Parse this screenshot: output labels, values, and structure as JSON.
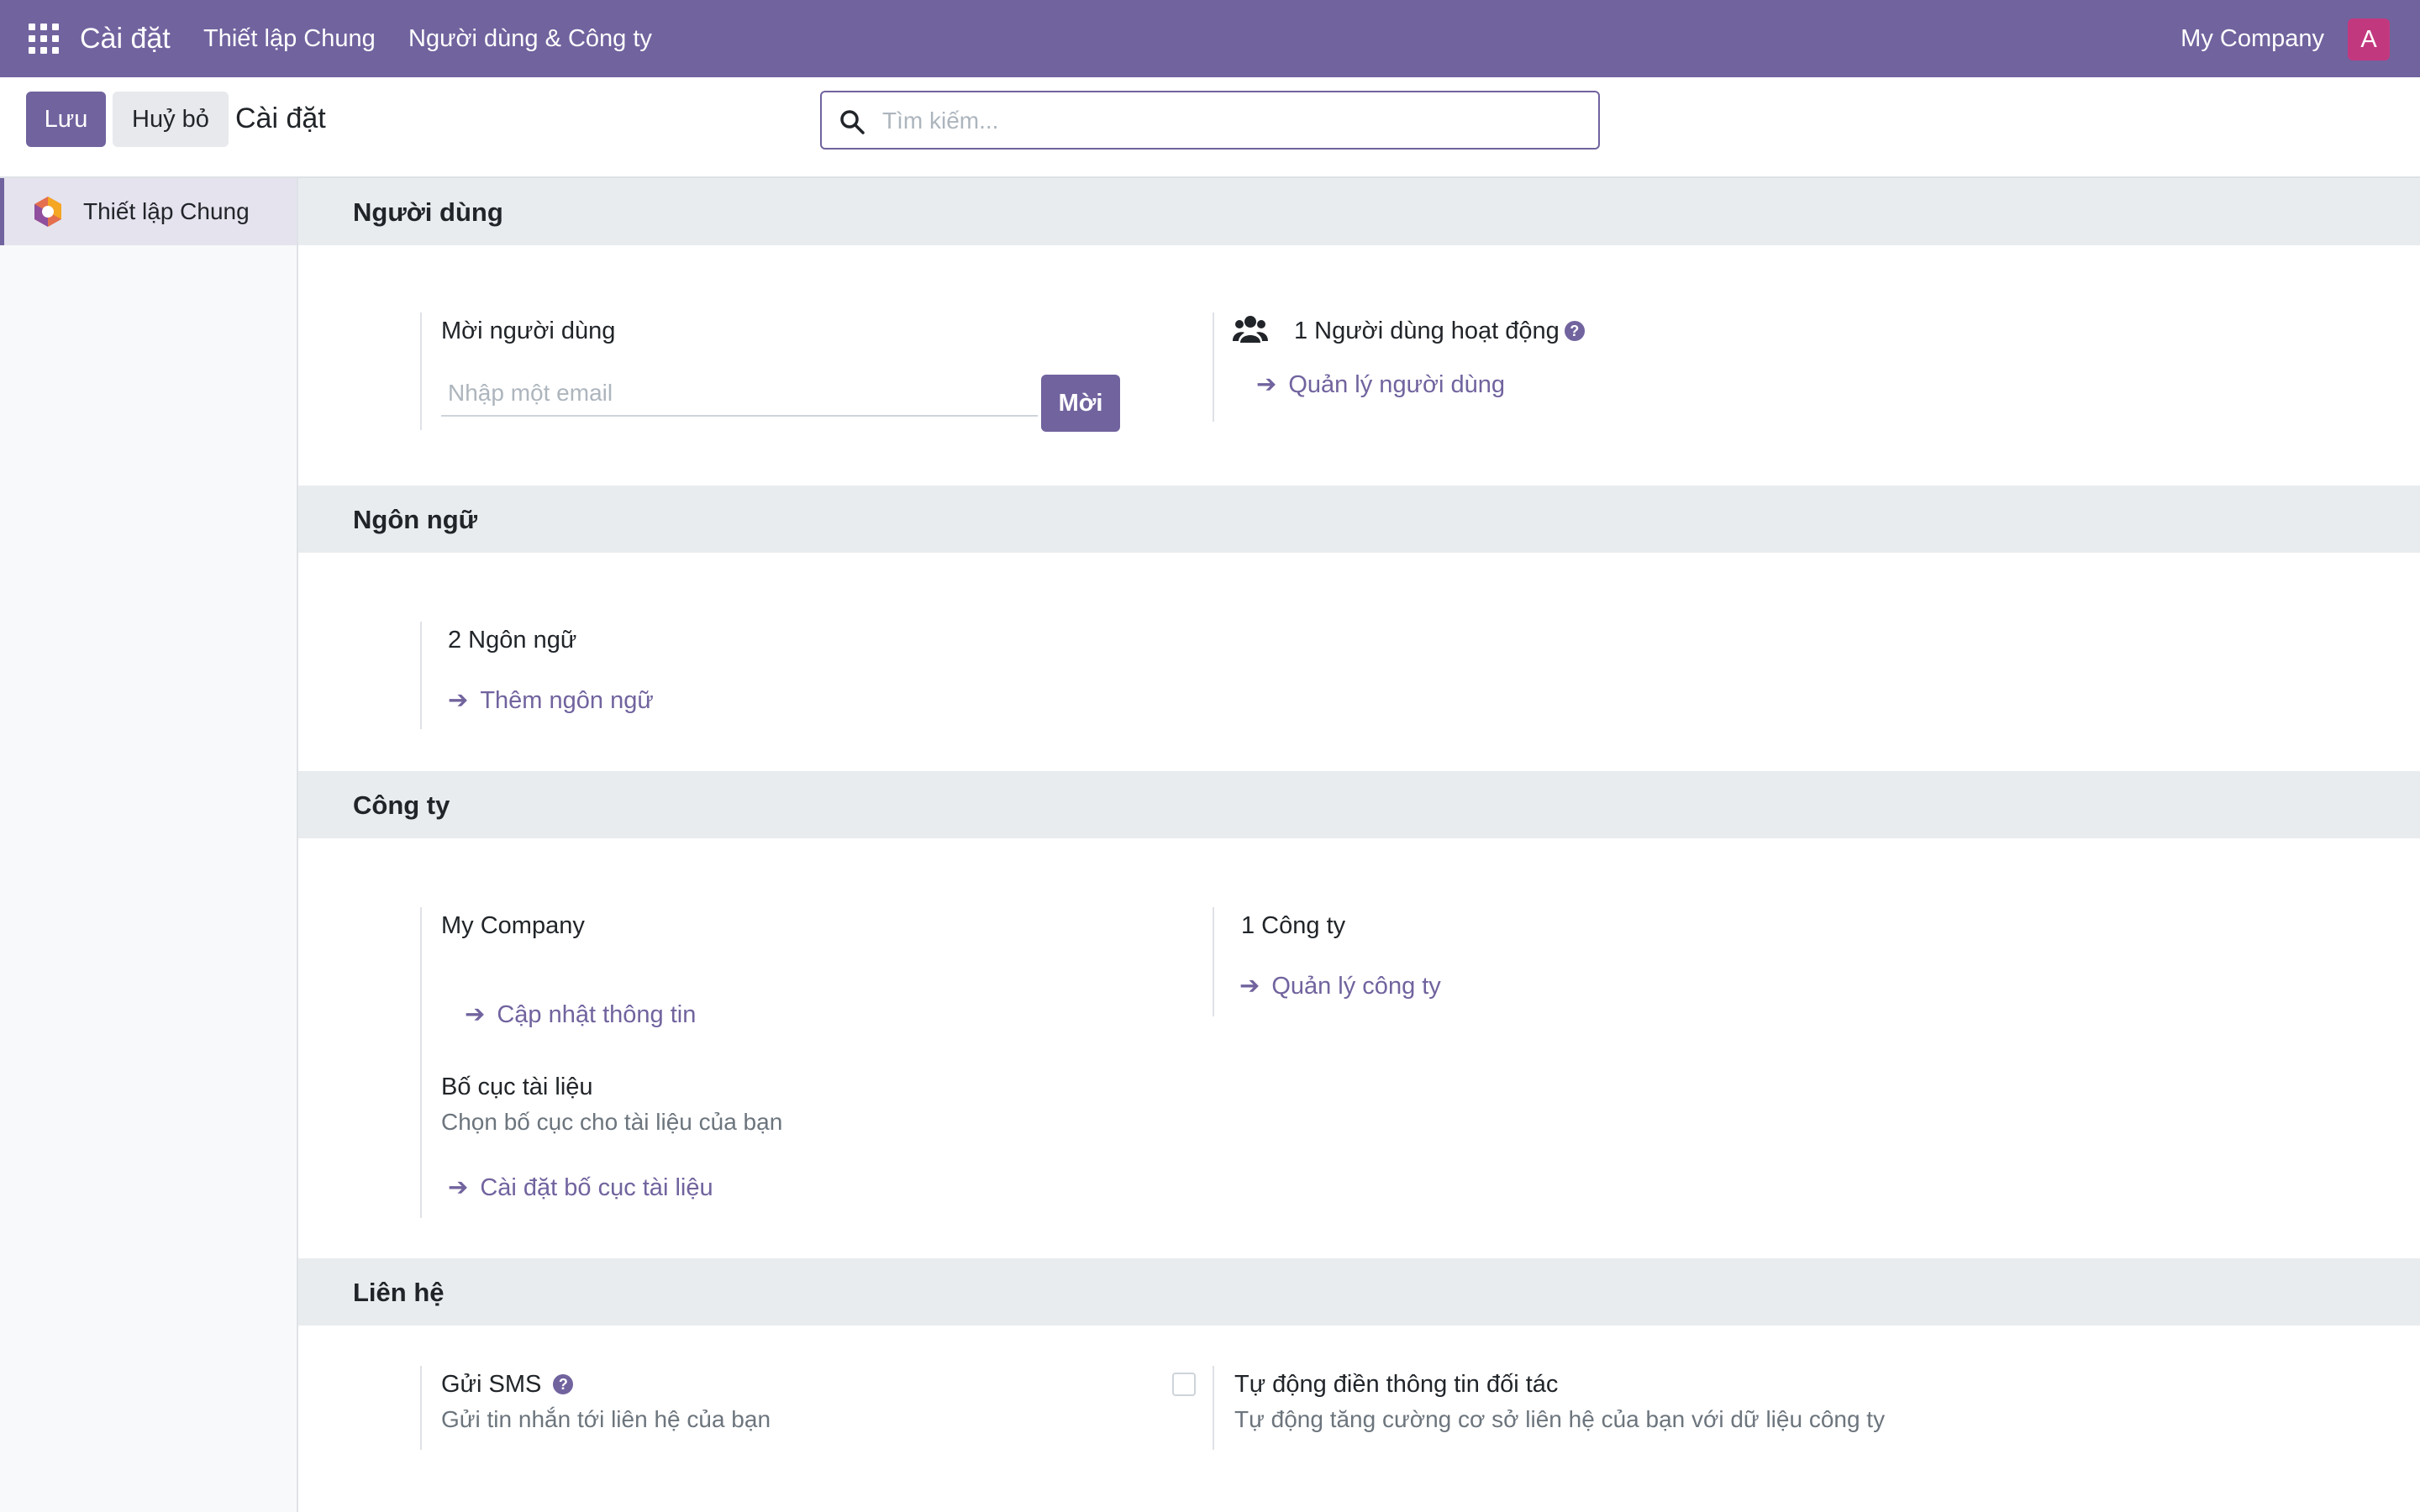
{
  "navbar": {
    "app_title": "Cài đặt",
    "menu": [
      "Thiết lập Chung",
      "Người dùng & Công ty"
    ],
    "company": "My Company",
    "avatar_initial": "A",
    "colors": {
      "bar": "#71639e",
      "avatar": "#c2387f"
    }
  },
  "control": {
    "save_label": "Lưu",
    "cancel_label": "Huỷ bỏ",
    "title": "Cài đặt",
    "search": {
      "placeholder": "Tìm kiếm...",
      "value": ""
    }
  },
  "sidebar": {
    "items": [
      {
        "label": "Thiết lập Chung",
        "icon": "settings-app-icon",
        "active": true
      }
    ]
  },
  "sections": {
    "users": {
      "heading": "Người dùng",
      "invite_title": "Mời người dùng",
      "invite_placeholder": "Nhập một email",
      "invite_button": "Mời",
      "active_users": "1 Người dùng hoạt động",
      "manage_users": "Quản lý người dùng"
    },
    "languages": {
      "heading": "Ngôn ngữ",
      "count": "2 Ngôn ngữ",
      "add_language": "Thêm ngôn ngữ"
    },
    "companies": {
      "heading": "Công ty",
      "company_name": "My Company",
      "update_info": "Cập nhật thông tin",
      "count": "1 Công ty",
      "manage_companies": "Quản lý công ty",
      "layout_title": "Bố cục tài liệu",
      "layout_desc": "Chọn bố cục cho tài liệu của bạn",
      "layout_link": "Cài đặt bố cục tài liệu"
    },
    "contacts": {
      "heading": "Liên hệ",
      "sms_title": "Gửi SMS",
      "sms_desc": "Gửi tin nhắn tới liên hệ của bạn",
      "autocomplete_title": "Tự động điền thông tin đối tác",
      "autocomplete_desc": "Tự động tăng cường cơ sở liên hệ của bạn với dữ liệu công ty",
      "autocomplete_checked": false
    }
  },
  "icons": {
    "apps": "apps-grid-icon",
    "search": "search-icon",
    "users": "users-icon",
    "help": "help-icon",
    "arrow": "arrow-right-icon"
  },
  "help_glyph": "?",
  "arrow_glyph": "➔"
}
